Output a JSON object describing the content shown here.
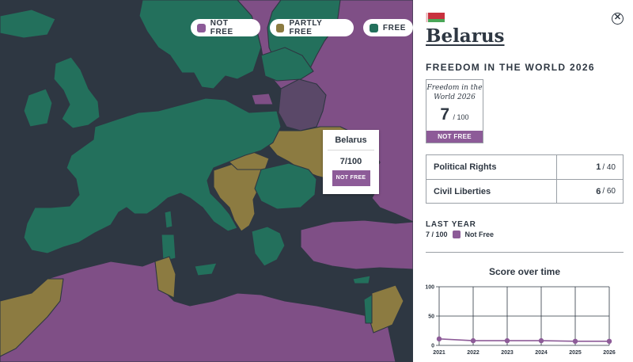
{
  "legend": {
    "not_free": "NOT FREE",
    "partly_free": "PARTLY FREE",
    "free": "FREE",
    "colors": {
      "not_free": "#8d5b98",
      "partly_free": "#8c7b41",
      "free": "#23705c"
    }
  },
  "tooltip": {
    "country": "Belarus",
    "score": "7/100",
    "status": "NOT FREE"
  },
  "panel": {
    "flag": {
      "icon": "belarus-flag-icon",
      "colors": [
        "#c8313e",
        "#4aa657"
      ]
    },
    "close_icon": "close-icon",
    "close_glyph": "✕",
    "country": "Belarus",
    "report_title": "FREEDOM IN THE WORLD 2026",
    "scorebox": {
      "title_line1": "Freedom in the",
      "title_line2": "World 2026",
      "score": "7",
      "out_of": "/ 100",
      "status": "NOT FREE"
    },
    "rights": [
      {
        "label": "Political Rights",
        "score": "1",
        "out_of": "/ 40"
      },
      {
        "label": "Civil Liberties",
        "score": "6",
        "out_of": "/ 60"
      }
    ],
    "last_year": {
      "label": "LAST YEAR",
      "score": "7 / 100",
      "status": "Not Free"
    },
    "chart_title": "Score over time"
  },
  "chart_data": {
    "type": "line",
    "title": "Score over time",
    "x": [
      "2021",
      "2022",
      "2023",
      "2024",
      "2025",
      "2026"
    ],
    "series": [
      {
        "values": [
          11,
          8,
          8,
          8,
          7,
          7
        ]
      }
    ],
    "yticks": [
      "0",
      "50",
      "100"
    ],
    "ylim": [
      0,
      100
    ],
    "grid": true,
    "color": "#8d5b98"
  }
}
